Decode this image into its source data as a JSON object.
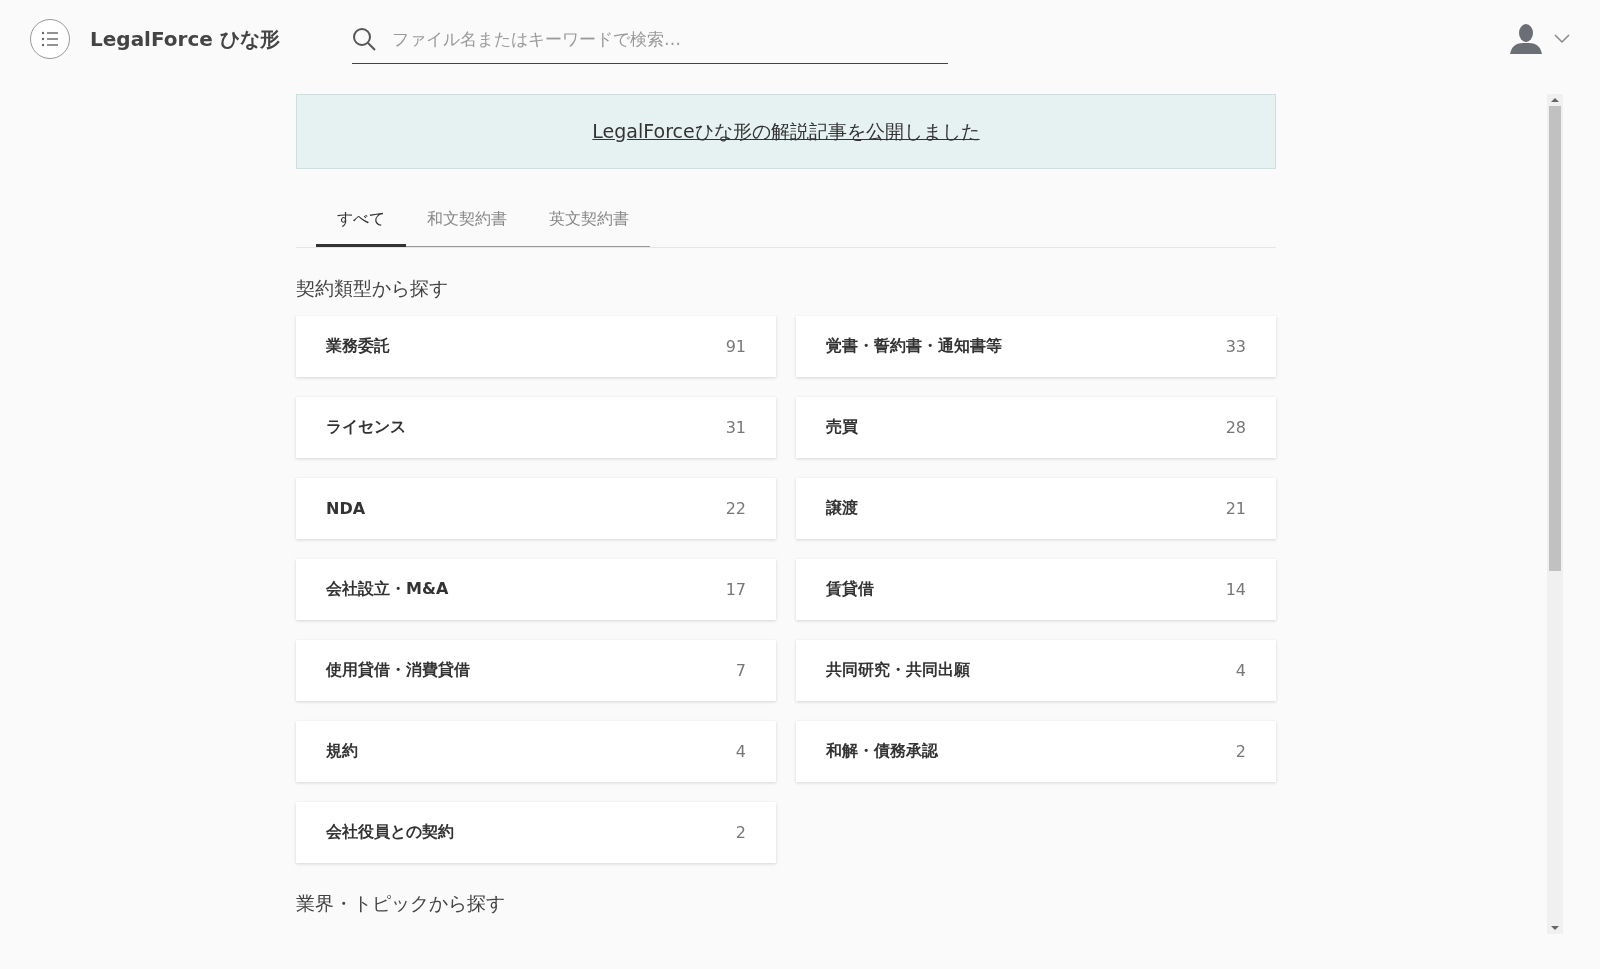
{
  "header": {
    "brand": "LegalForce ひな形",
    "search": {
      "placeholder": "ファイル名またはキーワードで検索…"
    }
  },
  "banner": {
    "link": "LegalForceひな形の解説記事を公開しました"
  },
  "tabs": [
    {
      "label": "すべて",
      "selected": true
    },
    {
      "label": "和文契約書",
      "selected": false
    },
    {
      "label": "英文契約書",
      "selected": false
    }
  ],
  "sections": [
    {
      "title": "契約類型から探す",
      "categories": [
        {
          "name": "業務委託",
          "count": "91"
        },
        {
          "name": "覚書・誓約書・通知書等",
          "count": "33"
        },
        {
          "name": "ライセンス",
          "count": "31"
        },
        {
          "name": "売買",
          "count": "28"
        },
        {
          "name": "NDA",
          "count": "22"
        },
        {
          "name": "譲渡",
          "count": "21"
        },
        {
          "name": "会社設立・M&A",
          "count": "17"
        },
        {
          "name": "賃貸借",
          "count": "14"
        },
        {
          "name": "使用貸借・消費貸借",
          "count": "7"
        },
        {
          "name": "共同研究・共同出願",
          "count": "4"
        },
        {
          "name": "規約",
          "count": "4"
        },
        {
          "name": "和解・債務承認",
          "count": "2"
        },
        {
          "name": "会社役員との契約",
          "count": "2"
        }
      ]
    },
    {
      "title": "業界・トピックから探す"
    }
  ]
}
